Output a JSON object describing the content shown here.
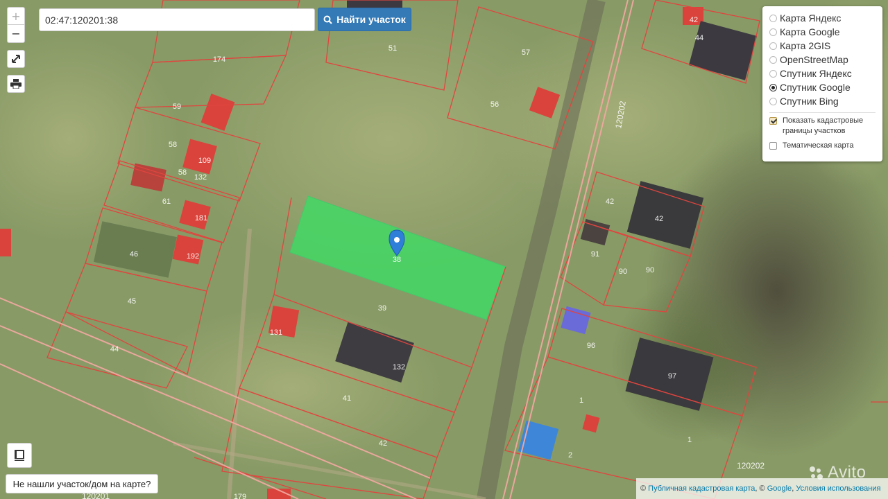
{
  "search": {
    "value": "02:47:120201:38",
    "button_label": "Найти участок"
  },
  "map_controls": {
    "zoom_in": "+",
    "zoom_out": "−"
  },
  "layers": [
    {
      "label": "Карта Яндекс",
      "selected": false
    },
    {
      "label": "Карта Google",
      "selected": false
    },
    {
      "label": "Карта 2GIS",
      "selected": false
    },
    {
      "label": "OpenStreetMap",
      "selected": false
    },
    {
      "label": "Спутник Яндекс",
      "selected": false
    },
    {
      "label": "Спутник Google",
      "selected": true
    },
    {
      "label": "Спутник Bing",
      "selected": false
    }
  ],
  "options": {
    "show_cadastral": {
      "label": "Показать кадастровые границы участков",
      "checked": true
    },
    "thematic": {
      "label": "Тематическая карта",
      "checked": false
    }
  },
  "not_found_button": "Не нашли участок/дом на карте?",
  "attribution": {
    "prefix": "©",
    "cadastral": "Публичная кадастровая карта",
    "sep1": ", ©",
    "google": "Google",
    "sep2": ",",
    "terms": "Условия использования"
  },
  "watermark": "Avito",
  "colors": {
    "parcel_border": "#e0453f",
    "highlight_fill": "#3ddc64",
    "pin": "#2f7ed8",
    "building_red": "#d9433b"
  },
  "map": {
    "quarter_labels": [
      "120202",
      "120202",
      "120201"
    ],
    "parcel_labels": [
      "174",
      "51",
      "57",
      "59",
      "56",
      "58",
      "109",
      "58",
      "132",
      "61",
      "181",
      "46",
      "192",
      "45",
      "44",
      "39",
      "38",
      "131",
      "132",
      "41",
      "42",
      "179",
      "44",
      "42",
      "42",
      "91",
      "90",
      "90",
      "96",
      "97",
      "1",
      "1",
      "2",
      "42"
    ]
  }
}
